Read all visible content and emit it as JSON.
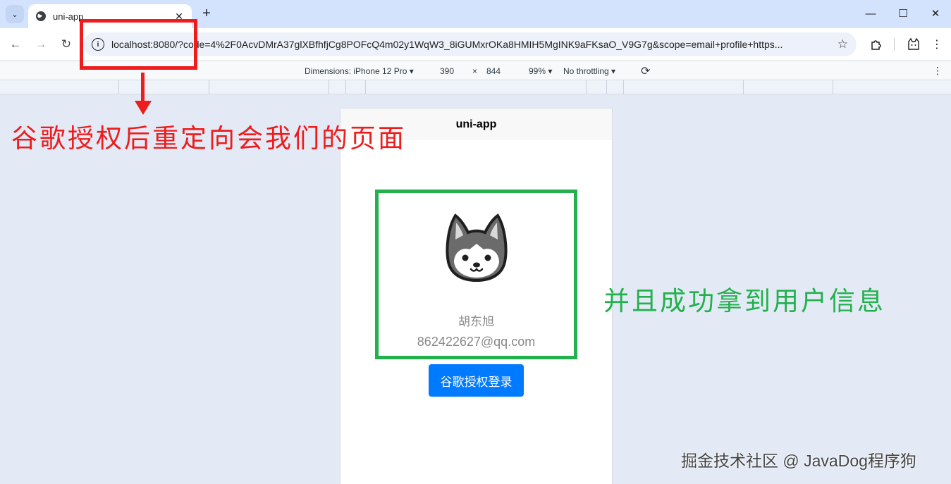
{
  "browser": {
    "tab_title": "uni-app",
    "url_host": "localhost",
    "url_rest": ":8080/?code=4%2F0AcvDMrA37glXBfhfjCg8POFcQ4m02y1WqW3_8iGUMxrOKa8HMIH5MgINK9aFKsaO_V9G7g&scope=email+profile+https..."
  },
  "devtools": {
    "dimensions_label": "Dimensions: iPhone 12 Pro",
    "width": "390",
    "times": "×",
    "height": "844",
    "zoom": "99%",
    "throttling": "No throttling"
  },
  "app": {
    "nav_title": "uni-app",
    "user_name": "胡东旭",
    "user_email": "862422627@qq.com",
    "login_button": "谷歌授权登录"
  },
  "annotations": {
    "red_note": "谷歌授权后重定向会我们的页面",
    "green_note": "并且成功拿到用户信息",
    "watermark": "掘金技术社区 @ JavaDog程序狗"
  },
  "colors": {
    "annotation_red": "#ee1c1c",
    "annotation_green": "#22b14c",
    "primary_button": "#007aff"
  }
}
